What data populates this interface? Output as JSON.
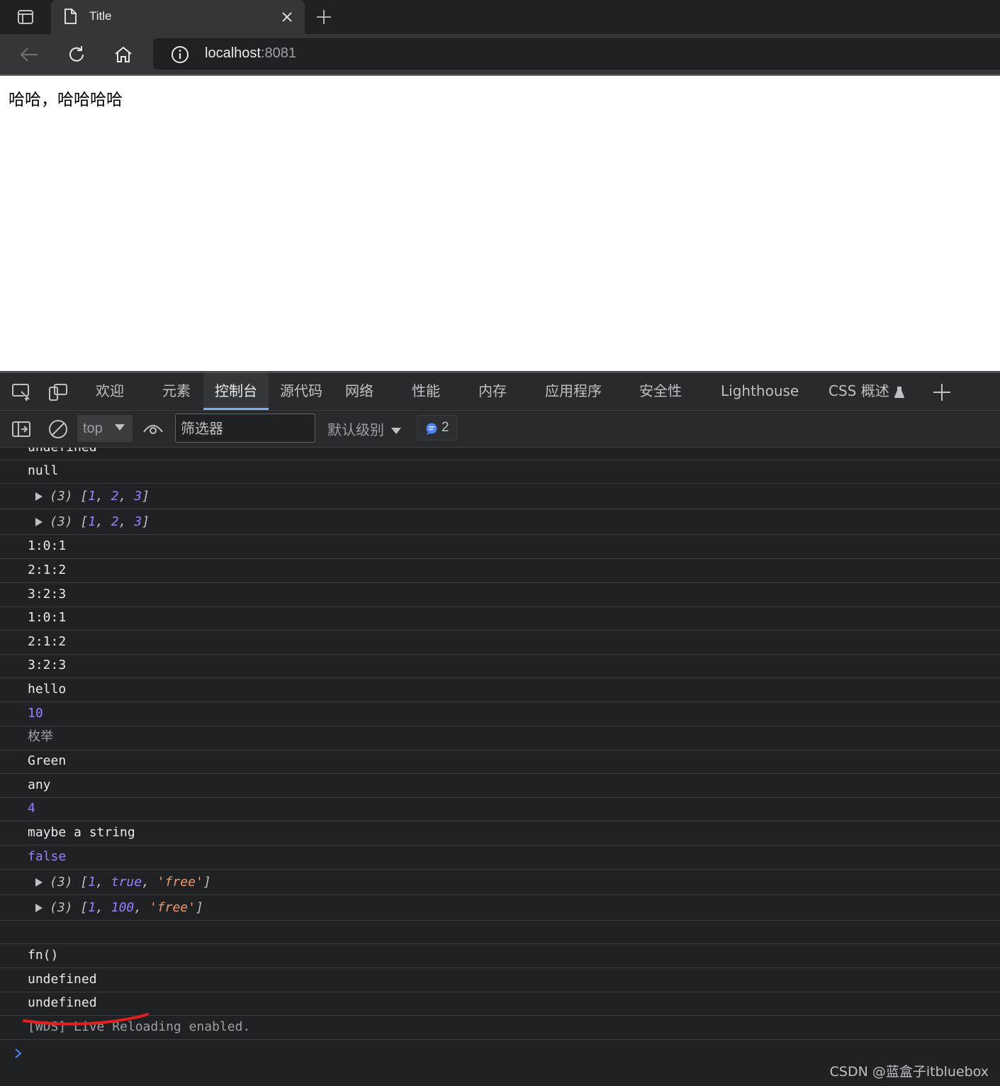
{
  "browser": {
    "tab_title": "Title",
    "url_host": "localhost",
    "url_port": ":8081",
    "icons": [
      "sidebar-toggle-icon",
      "page-icon",
      "close-icon",
      "plus-icon",
      "back-arrow-icon",
      "reload-icon",
      "home-icon",
      "info-icon"
    ]
  },
  "page": {
    "body_text": "哈哈，哈哈哈哈"
  },
  "devtools": {
    "tabs": [
      "欢迎",
      "元素",
      "控制台",
      "源代码",
      "网络",
      "性能",
      "内存",
      "应用程序",
      "安全性",
      "Lighthouse",
      "CSS 概述"
    ],
    "active_tab": "控制台",
    "context": "top",
    "filter_placeholder": "筛选器",
    "levels_label": "默认级别",
    "issues_count": "2",
    "accent_color": "#7cacf8"
  },
  "console": {
    "rows": {
      "r0": "undefined",
      "r1": "null",
      "r2_count": "(3)",
      "r2": [
        "1",
        "2",
        "3"
      ],
      "r3_count": "(3)",
      "r3": [
        "1",
        "2",
        "3"
      ],
      "r4": "1:0:1",
      "r5": "2:1:2",
      "r6": "3:2:3",
      "r7": "1:0:1",
      "r8": "2:1:2",
      "r9": "3:2:3",
      "r10": "hello",
      "r11": "10",
      "r12": "枚举",
      "r13": "Green",
      "r14": "any",
      "r15": "4",
      "r16": "maybe a string",
      "r17": "false",
      "r18_count": "(3)",
      "r18": [
        "1",
        "true",
        "'free'"
      ],
      "r19_count": "(3)",
      "r19": [
        "1",
        "100",
        "'free'"
      ],
      "r21": "fn()",
      "r22": "undefined",
      "r23": "undefined",
      "r24": "[WDS] Live Reloading enabled."
    }
  },
  "watermark": "CSDN @蓝盒子itbluebox"
}
